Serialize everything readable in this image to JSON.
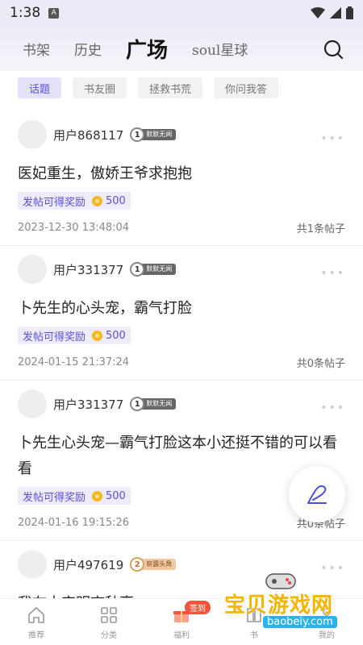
{
  "status_bar": {
    "time": "1:38",
    "notif_icon": "A"
  },
  "top_nav": {
    "tabs": [
      {
        "label": "书架"
      },
      {
        "label": "历史"
      },
      {
        "label": "广场",
        "active": true
      },
      {
        "label": "soul星球"
      }
    ]
  },
  "chips": [
    {
      "label": "话题",
      "active": true
    },
    {
      "label": "书友圈"
    },
    {
      "label": "拯救书荒"
    },
    {
      "label": "你问我答"
    }
  ],
  "posts": [
    {
      "user": "用户868117",
      "level_num": "1",
      "level_title": "默默无闻",
      "title": "医妃重生，傲娇王爷求抱抱",
      "reward_label": "发帖可得奖励",
      "reward_amount": "500",
      "date": "2023-12-30 13:48:04",
      "count": "共1条帖子"
    },
    {
      "user": "用户331377",
      "level_num": "1",
      "level_title": "默默无闻",
      "title": "卜先生的心头宠，霸气打脸",
      "reward_label": "发帖可得奖励",
      "reward_amount": "500",
      "date": "2024-01-15 21:37:24",
      "count": "共0条帖子"
    },
    {
      "user": "用户331377",
      "level_num": "1",
      "level_title": "默默无闻",
      "title": "卜先生心头宠—霸气打脸这本小还挺不错的可以看看",
      "reward_label": "发帖可得奖励",
      "reward_amount": "500",
      "date": "2024-01-16 19:15:26",
      "count": "共0条帖子"
    },
    {
      "user": "用户497619",
      "level_num": "2",
      "level_title": "崭露头角",
      "title": "我在大宋明查秋豪"
    }
  ],
  "bottom_nav": {
    "items": [
      {
        "label": "推荐",
        "icon": "home-icon"
      },
      {
        "label": "分类",
        "icon": "grid-icon"
      },
      {
        "label": "福利",
        "icon": "gift-icon",
        "badge": "签到"
      },
      {
        "label": "书",
        "icon": "book-icon"
      },
      {
        "label": "我的",
        "icon": "user-icon"
      }
    ]
  },
  "watermark": {
    "text": "宝贝游戏网",
    "url": "baobeiy.com"
  },
  "colors": {
    "accent": "#5a50d8",
    "badge_red": "#f2553b",
    "coin": "#f4b824"
  }
}
